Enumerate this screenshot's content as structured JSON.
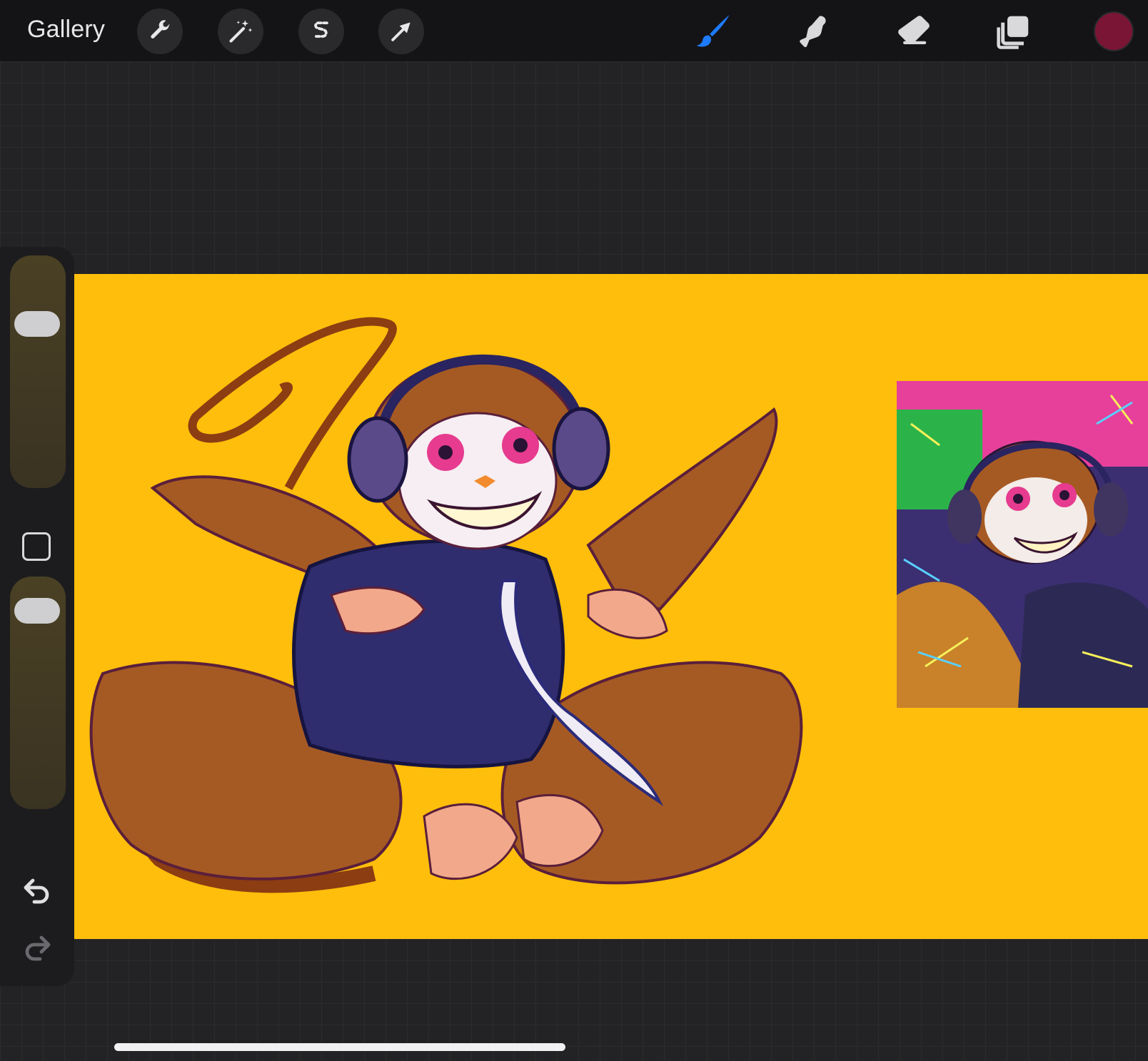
{
  "topbar": {
    "gallery_label": "Gallery",
    "left_tools": [
      {
        "name": "actions",
        "icon": "wrench-icon"
      },
      {
        "name": "adjustments",
        "icon": "magic-wand-icon"
      },
      {
        "name": "selection",
        "icon": "selection-s-icon"
      },
      {
        "name": "transform",
        "icon": "arrow-icon"
      }
    ],
    "right_tools": [
      {
        "name": "brush",
        "icon": "brush-icon",
        "active": true,
        "color": "#1e7bff"
      },
      {
        "name": "smudge",
        "icon": "smudge-icon",
        "active": false
      },
      {
        "name": "eraser",
        "icon": "eraser-icon",
        "active": false
      },
      {
        "name": "layers",
        "icon": "layers-icon",
        "active": false
      }
    ],
    "current_color": "#7a1535"
  },
  "sidebar": {
    "brush_size_icon": "slider-thumb",
    "opacity_icon": "slider-thumb",
    "modify_icon": "square-icon",
    "undo_icon": "undo-icon",
    "redo_icon": "redo-icon"
  },
  "canvas": {
    "background_color": "#ffbe0b",
    "artwork": "monkey-with-headphones-illustration"
  }
}
